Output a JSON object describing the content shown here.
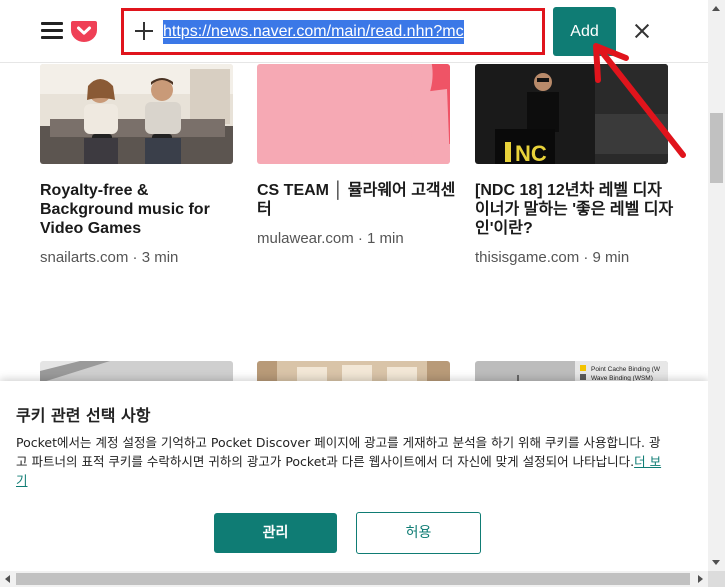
{
  "toolbar": {
    "url_value": "https://news.naver.com/main/read.nhn?mc",
    "add_label": "Add"
  },
  "cards": [
    {
      "title": "Royalty-free & Background music for Video Games",
      "meta": "snailarts.com · 3 min"
    },
    {
      "title": "CS TEAM │ 뮬라웨어 고객센터",
      "meta": "mulawear.com · 1 min"
    },
    {
      "title": "[NDC 18] 12년차 레벨 디자이너가 말하는 '좋은 레벨 디자인'이란?",
      "meta": "thisisgame.com · 9 min"
    }
  ],
  "row2_thumb3": {
    "line1": "Point Cache Binding (W",
    "line2": "Wave Binding (WSM)"
  },
  "cookie": {
    "title": "쿠키 관련 선택 사항",
    "body": "Pocket에서는 계정 설정을 기억하고 Pocket Discover 페이지에 광고를 게재하고 분석을 하기 위해 쿠키를 사용합니다. 광고 파트너의 표적 쿠키를 수락하시면 귀하의 광고가 Pocket과 다른 웹사이트에서 더 자신에 맞게 설정되어 나타납니다.",
    "link": "더 보기",
    "manage_label": "관리",
    "allow_label": "허용"
  },
  "colors": {
    "accent": "#0f7c74",
    "highlight_red": "#e0141c",
    "pocket_red": "#ef4056",
    "selection_blue": "#3b78e7"
  }
}
